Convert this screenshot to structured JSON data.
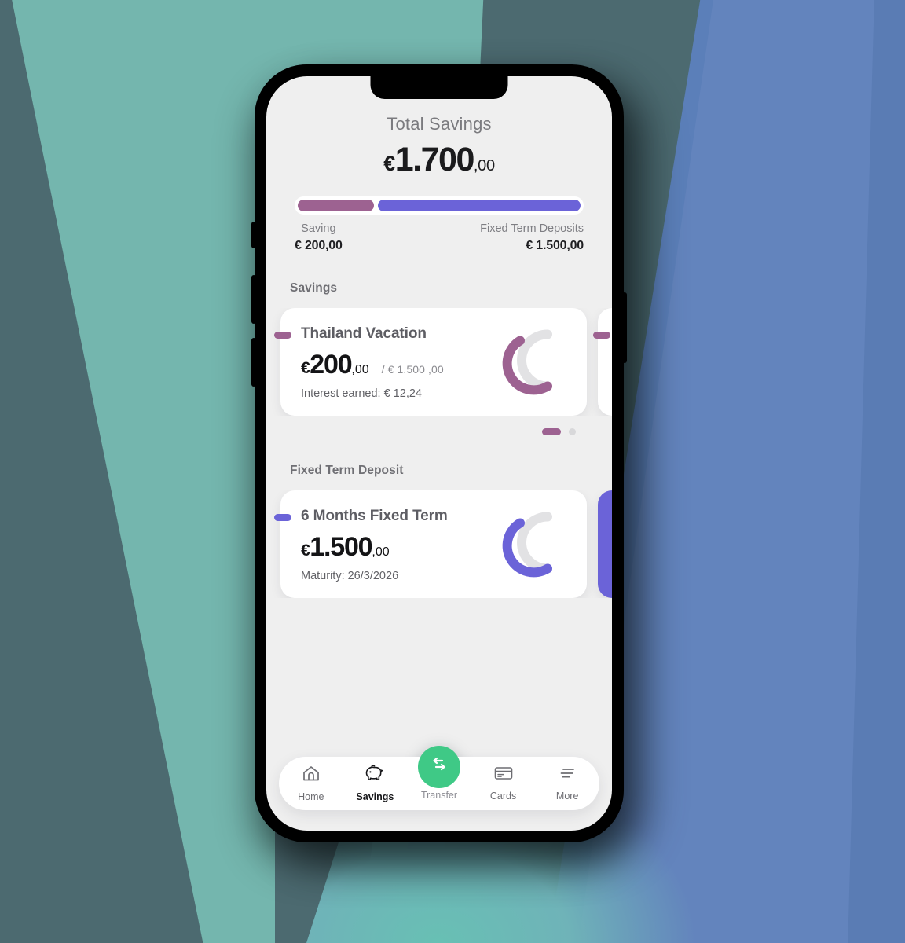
{
  "background": {
    "teal": "#74b6ae",
    "slate": "#4c6a70",
    "blue": "#6384bd",
    "blue_dark": "#5a7cb4"
  },
  "theme": {
    "screen_bg": "#efefef",
    "card_bg": "#ffffff",
    "savings_accent": "#9d6291",
    "deposit_accent": "#6b63d8",
    "fab_green": "#3fc986",
    "text_primary": "#17171a",
    "text_muted": "#7b7b7f"
  },
  "summary": {
    "title": "Total Savings",
    "amount_currency": "€",
    "amount_major": "1.700",
    "amount_minor": ",00",
    "bar": {
      "savings_percent": 27,
      "deposits_percent": 73
    },
    "legend": [
      {
        "name": "Saving",
        "value": "€ 200,00"
      },
      {
        "name": "Fixed Term Deposits",
        "value": "€ 1.500,00"
      }
    ]
  },
  "sections": [
    {
      "title": "Savings",
      "accent": "#9d6291",
      "card": {
        "name": "Thailand Vacation",
        "currency": "€",
        "major": "200",
        "minor": ",00",
        "goal": "/ € 1.500 ,00",
        "sub": "Interest earned: € 12,24",
        "progress_percent": 62
      },
      "pagination": {
        "active_index": 0,
        "count": 2
      }
    },
    {
      "title": "Fixed Term Deposit",
      "accent": "#6b63d8",
      "card": {
        "name": "6 Months Fixed Term",
        "currency": "€",
        "major": "1.500",
        "minor": ",00",
        "goal": "",
        "sub": "Maturity: 26/3/2026",
        "progress_percent": 62
      }
    }
  ],
  "navbar": {
    "items": [
      {
        "label": "Home",
        "icon": "home-icon",
        "active": false
      },
      {
        "label": "Savings",
        "icon": "piggy-bank-icon",
        "active": true
      },
      {
        "label": "Transfer",
        "icon": "transfer-icon",
        "active": false
      },
      {
        "label": "Cards",
        "icon": "credit-card-icon",
        "active": false
      },
      {
        "label": "More",
        "icon": "more-lines-icon",
        "active": false
      }
    ]
  }
}
